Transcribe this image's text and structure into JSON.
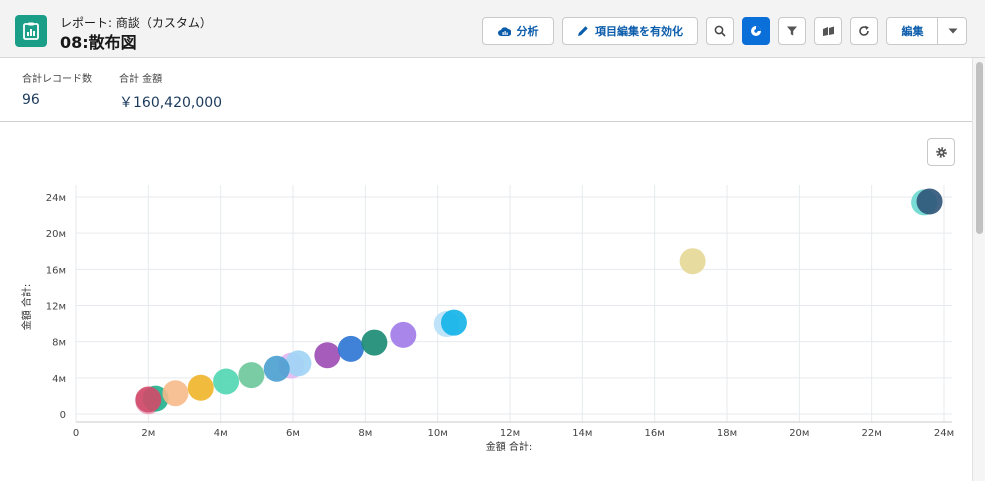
{
  "header": {
    "subtitle": "レポート: 商談（カスタム）",
    "title": "08:散布図",
    "analyze_label": "分析",
    "inline_edit_label": "項目編集を有効化",
    "edit_label": "編集"
  },
  "summary": {
    "record_count_label": "合計レコード数",
    "record_count_value": "96",
    "amount_label": "合計 金額",
    "amount_value": "￥160,420,000"
  },
  "colors": {
    "brand": "#1b9e87",
    "accent": "#0b6fd9"
  },
  "chart_data": {
    "type": "scatter",
    "xlabel": "金額 合計:",
    "ylabel": "金額 合計:",
    "xlim": [
      0,
      24000000
    ],
    "ylim": [
      0,
      24000000
    ],
    "x_ticks": [
      "0",
      "2м",
      "4м",
      "6м",
      "8м",
      "10м",
      "12м",
      "14м",
      "16м",
      "18м",
      "20м",
      "22м",
      "24м"
    ],
    "y_ticks": [
      "0",
      "4м",
      "8м",
      "12м",
      "16м",
      "20м",
      "24м"
    ],
    "grid": true,
    "points": [
      {
        "x": 2000000,
        "y": 1400000,
        "color": "#e8a0b8"
      },
      {
        "x": 2200000,
        "y": 1700000,
        "color": "#1fb08c"
      },
      {
        "x": 2000000,
        "y": 1600000,
        "color": "#d24a6a"
      },
      {
        "x": 2750000,
        "y": 2300000,
        "color": "#f7b98a"
      },
      {
        "x": 3450000,
        "y": 2900000,
        "color": "#f0b429"
      },
      {
        "x": 4150000,
        "y": 3600000,
        "color": "#4fd6b0"
      },
      {
        "x": 4850000,
        "y": 4300000,
        "color": "#6cc79a"
      },
      {
        "x": 5950000,
        "y": 5350000,
        "color": "#e2b8f2"
      },
      {
        "x": 6150000,
        "y": 5600000,
        "color": "#9fd4f5"
      },
      {
        "x": 5550000,
        "y": 5000000,
        "color": "#4a9fd0"
      },
      {
        "x": 6950000,
        "y": 6500000,
        "color": "#9b4ab4"
      },
      {
        "x": 7600000,
        "y": 7200000,
        "color": "#2b74d4"
      },
      {
        "x": 8250000,
        "y": 7900000,
        "color": "#178a72"
      },
      {
        "x": 9050000,
        "y": 8750000,
        "color": "#a07ae8"
      },
      {
        "x": 10250000,
        "y": 9950000,
        "color": "#b8e0f8"
      },
      {
        "x": 10450000,
        "y": 10100000,
        "color": "#12b2e8"
      },
      {
        "x": 17050000,
        "y": 16900000,
        "color": "#e6d796"
      },
      {
        "x": 23450000,
        "y": 23400000,
        "color": "#6ad8d0"
      },
      {
        "x": 23600000,
        "y": 23500000,
        "color": "#2e5478"
      }
    ]
  }
}
